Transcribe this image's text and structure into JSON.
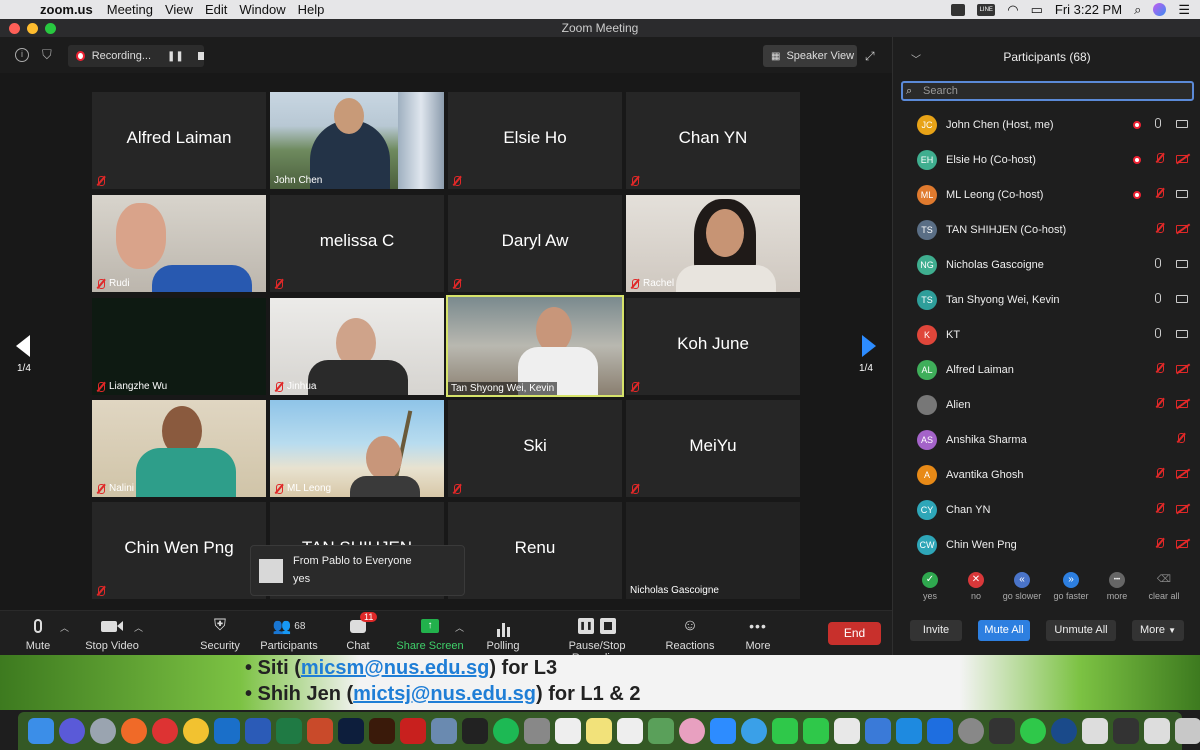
{
  "menubar": {
    "app": "zoom.us",
    "items": [
      "Meeting",
      "View",
      "Edit",
      "Window",
      "Help"
    ],
    "clock": "Fri 3:22 PM",
    "line_icon": "LINE"
  },
  "window": {
    "title": "Zoom Meeting"
  },
  "top": {
    "recording": "Recording...",
    "speaker_view": "Speaker View"
  },
  "grid": {
    "page_left": "1/4",
    "page_right": "1/4",
    "tiles": [
      {
        "name": "Alfred Laiman",
        "video": false,
        "muted": true
      },
      {
        "name": "John Chen",
        "video": true,
        "muted": false
      },
      {
        "name": "Elsie Ho",
        "video": false,
        "muted": true
      },
      {
        "name": "Chan YN",
        "video": false,
        "muted": true
      },
      {
        "name": "Rudi",
        "video": true,
        "muted": true
      },
      {
        "name": "melissa C",
        "video": false,
        "muted": true
      },
      {
        "name": "Daryl Aw",
        "video": false,
        "muted": true
      },
      {
        "name": "Rachel",
        "video": true,
        "muted": true
      },
      {
        "name": "Liangzhe Wu",
        "video": true,
        "muted": true
      },
      {
        "name": "Jinhua",
        "video": true,
        "muted": true
      },
      {
        "name": "Tan Shyong Wei, Kevin",
        "video": true,
        "muted": false
      },
      {
        "name": "Koh June",
        "video": false,
        "muted": true
      },
      {
        "name": "Nalini",
        "video": true,
        "muted": true
      },
      {
        "name": "ML Leong",
        "video": true,
        "muted": true
      },
      {
        "name": "Ski",
        "video": false,
        "muted": true
      },
      {
        "name": "MeiYu",
        "video": false,
        "muted": true
      },
      {
        "name": "Chin Wen Png",
        "video": false,
        "muted": true
      },
      {
        "name": "TAN SHIHJEN",
        "video": false,
        "muted": true
      },
      {
        "name": "Renu",
        "video": false,
        "muted": true
      },
      {
        "name": "Nicholas Gascoigne",
        "video": true,
        "muted": false
      }
    ]
  },
  "chat_popup": {
    "from": "From Pablo to Everyone",
    "message": "yes"
  },
  "toolbar": {
    "mute": "Mute",
    "stop_video": "Stop Video",
    "security": "Security",
    "participants": "Participants",
    "participants_count": "68",
    "chat": "Chat",
    "chat_badge": "11",
    "share_screen": "Share Screen",
    "polling": "Polling",
    "pause_recording": "Pause/Stop Recording",
    "reactions": "Reactions",
    "more": "More",
    "end": "End"
  },
  "panel": {
    "title": "Participants (68)",
    "search_placeholder": "Search",
    "participants": [
      {
        "initials": "JC",
        "name": "John Chen (Host, me)",
        "color": "#e8a317",
        "rec": true,
        "mic": "on",
        "cam": "on"
      },
      {
        "initials": "EH",
        "name": "Elsie Ho (Co-host)",
        "color": "#3fae8f",
        "rec": true,
        "mic": "off",
        "cam": "off"
      },
      {
        "initials": "ML",
        "name": "ML Leong (Co-host)",
        "color": "#e07a2e",
        "rec": true,
        "mic": "off",
        "cam": "on"
      },
      {
        "initials": "TS",
        "name": "TAN SHIHJEN (Co-host)",
        "color": "#5a6e85",
        "rec": false,
        "mic": "off",
        "cam": "off"
      },
      {
        "initials": "NG",
        "name": "Nicholas Gascoigne",
        "color": "#3fae8f",
        "rec": false,
        "mic": "on",
        "cam": "on"
      },
      {
        "initials": "TS",
        "name": "Tan Shyong Wei, Kevin",
        "color": "#2e9e9a",
        "rec": false,
        "mic": "on",
        "cam": "on"
      },
      {
        "initials": "K",
        "name": "KT",
        "color": "#e0463a",
        "rec": false,
        "mic": "on",
        "cam": "on"
      },
      {
        "initials": "AL",
        "name": "Alfred Laiman",
        "color": "#3fae5a",
        "rec": false,
        "mic": "off",
        "cam": "off"
      },
      {
        "initials": "",
        "name": "Alien",
        "color": "#777777",
        "rec": false,
        "mic": "off",
        "cam": "off"
      },
      {
        "initials": "AS",
        "name": "Anshika Sharma",
        "color": "#a463c9",
        "rec": false,
        "mic": "off",
        "cam": "none"
      },
      {
        "initials": "A",
        "name": "Avantika Ghosh",
        "color": "#e88a17",
        "rec": false,
        "mic": "off",
        "cam": "off"
      },
      {
        "initials": "CY",
        "name": "Chan YN",
        "color": "#2ea6b8",
        "rec": false,
        "mic": "off",
        "cam": "off"
      },
      {
        "initials": "CW",
        "name": "Chin Wen Png",
        "color": "#2ea6b8",
        "rec": false,
        "mic": "off",
        "cam": "off"
      }
    ],
    "reactions": [
      {
        "label": "yes",
        "color": "#2fa84f",
        "glyph": "✓"
      },
      {
        "label": "no",
        "color": "#d9383a",
        "glyph": "✕"
      },
      {
        "label": "go slower",
        "color": "#4a74c9",
        "glyph": "«"
      },
      {
        "label": "go faster",
        "color": "#2d7fe0",
        "glyph": "»"
      },
      {
        "label": "more",
        "color": "#666666",
        "glyph": "•••"
      },
      {
        "label": "clear all",
        "color": "#1e1e1e",
        "glyph": "⌫"
      }
    ],
    "invite": "Invite",
    "mute_all": "Mute All",
    "unmute_all": "Unmute All",
    "more": "More"
  },
  "slide": {
    "line1_prefix": "• Siti (",
    "line1_link": "micsm@nus.edu.sg",
    "line1_suffix": ") for L3",
    "line2_prefix": "• Shih Jen (",
    "line2_link": "mictsj@nus.edu.sg",
    "line2_suffix": ") for L1 & 2"
  },
  "colors": {
    "accent": "#2d8cff",
    "end": "#c8302c",
    "muted": "#e02828",
    "share": "#22b14c"
  }
}
